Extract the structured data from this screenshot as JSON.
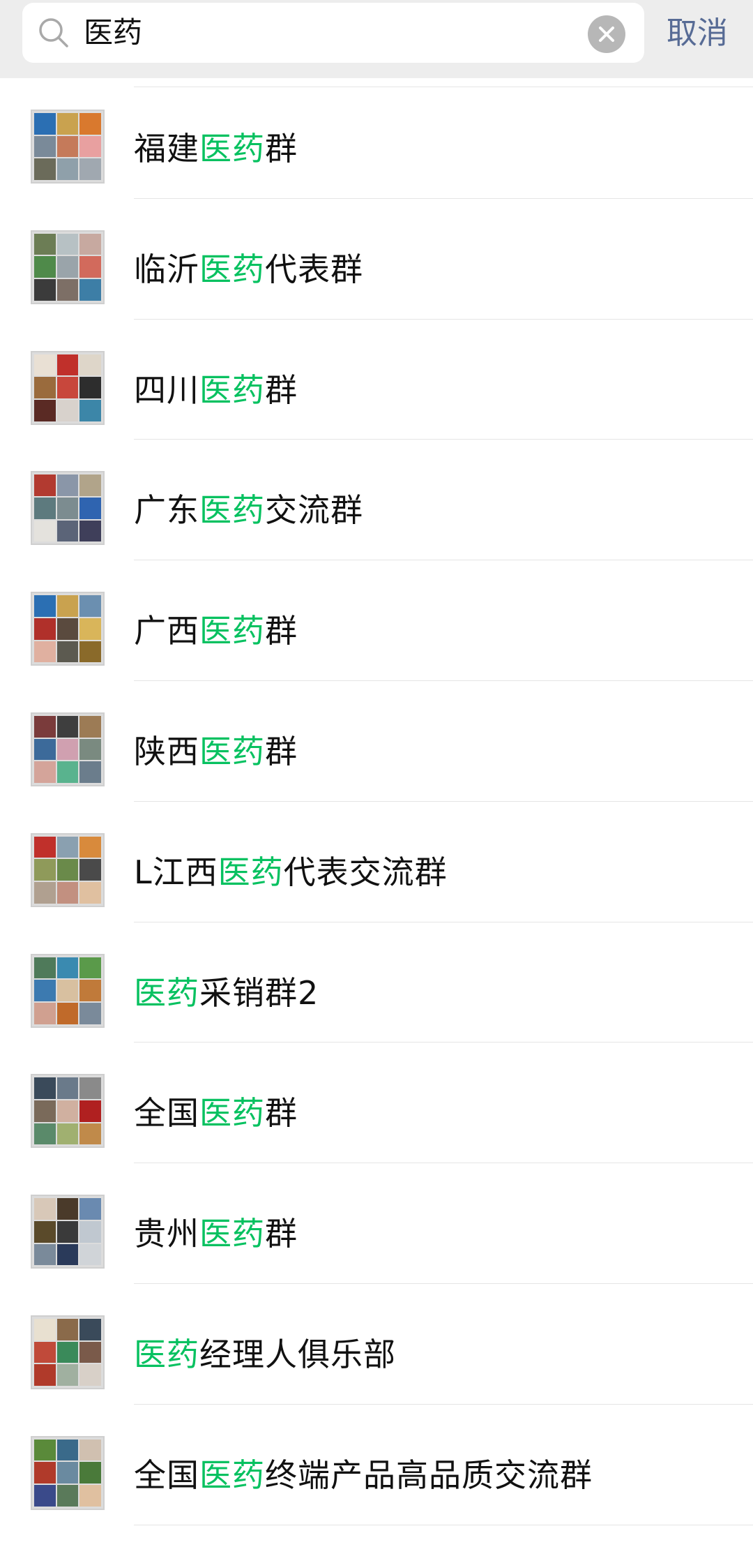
{
  "search": {
    "query": "医药",
    "cancel_label": "取消"
  },
  "colors": {
    "highlight": "#07c160",
    "cancel_link": "#576b95",
    "top_bar_bg": "#ededed"
  },
  "results": [
    {
      "prefix": "福建",
      "match": "医药",
      "suffix": "群",
      "avatar": [
        "#2b6fb3",
        "#c9a24f",
        "#d9792e",
        "#7a8a99",
        "#c57a5a",
        "#e8a0a0",
        "#6b6b5a",
        "#8fa0aa",
        "#a0a8b0"
      ]
    },
    {
      "prefix": "临沂",
      "match": "医药",
      "suffix": "代表群",
      "avatar": [
        "#6c7d55",
        "#b7c1c4",
        "#c7a9a0",
        "#4f8a4a",
        "#9aa4aa",
        "#d26a5c",
        "#3b3b3b",
        "#7d6f66",
        "#3d7ea6"
      ]
    },
    {
      "prefix": "四川",
      "match": "医药",
      "suffix": "群",
      "avatar": [
        "#e9e0d4",
        "#c0302b",
        "#ded6c9",
        "#9a6b3d",
        "#c8473c",
        "#2d2d2d",
        "#5a2a24",
        "#d8d2cc",
        "#3c86a8"
      ]
    },
    {
      "prefix": "广东",
      "match": "医药",
      "suffix": "交流群",
      "avatar": [
        "#b23a30",
        "#8a96a8",
        "#b1a48a",
        "#5d7a7e",
        "#7c8c90",
        "#2f64b0",
        "#e4e2dd",
        "#5b6478",
        "#3f3f5a"
      ]
    },
    {
      "prefix": "广西",
      "match": "医药",
      "suffix": "群",
      "avatar": [
        "#2b6fb3",
        "#c9a24f",
        "#6b8fb0",
        "#b0302a",
        "#5a4a3e",
        "#d9b55a",
        "#e0b0a0",
        "#5c5a50",
        "#8a6a2a"
      ]
    },
    {
      "prefix": "陕西",
      "match": "医药",
      "suffix": "群",
      "avatar": [
        "#7a3b3b",
        "#3e3e3e",
        "#9c7b55",
        "#3c6a9a",
        "#d0a0b0",
        "#7a8a80",
        "#d4a49a",
        "#59b38e",
        "#6b7d8c"
      ]
    },
    {
      "prefix": "L江西",
      "match": "医药",
      "suffix": "代表交流群",
      "avatar": [
        "#c0302b",
        "#8aa0b0",
        "#d88a3c",
        "#8f9a5a",
        "#6a8a4a",
        "#4a4a4a",
        "#b0a090",
        "#c29080",
        "#e0c0a0"
      ]
    },
    {
      "prefix": "",
      "match": "医药",
      "suffix": "采销群2",
      "avatar": [
        "#4f7a5a",
        "#3a8ab0",
        "#5a9a4a",
        "#3c7ab0",
        "#d8c0a0",
        "#c07a3a",
        "#d0a090",
        "#c06a2a",
        "#7a8a9a"
      ]
    },
    {
      "prefix": "全国",
      "match": "医药",
      "suffix": "群",
      "avatar": [
        "#3a4a5a",
        "#6a7a8a",
        "#8a8a8a",
        "#7a6a5a",
        "#d0b0a0",
        "#b02020",
        "#5a8a6a",
        "#a0b070",
        "#c08a4a"
      ]
    },
    {
      "prefix": "贵州",
      "match": "医药",
      "suffix": "群",
      "avatar": [
        "#d8c8b8",
        "#4a3a2a",
        "#6a8ab0",
        "#5a4a2a",
        "#3a3a3a",
        "#c0c8d0",
        "#7a8a9a",
        "#2a3a5a",
        "#d0d4d8"
      ]
    },
    {
      "prefix": "",
      "match": "医药",
      "suffix": "经理人俱乐部",
      "avatar": [
        "#e8e0d0",
        "#8a6a4a",
        "#3a4a5a",
        "#c04a3a",
        "#3a8a5a",
        "#7a5a4a",
        "#b03a2a",
        "#a0b0a0",
        "#d8d0c8"
      ]
    },
    {
      "prefix": "全国",
      "match": "医药",
      "suffix": "终端产品高品质交流群",
      "avatar": [
        "#5a8a3a",
        "#3a6a8a",
        "#d0c0b0",
        "#b03a2a",
        "#6a8aa0",
        "#4a7a3a",
        "#3a4a8a",
        "#5a7a5a",
        "#e0c0a0"
      ]
    }
  ]
}
